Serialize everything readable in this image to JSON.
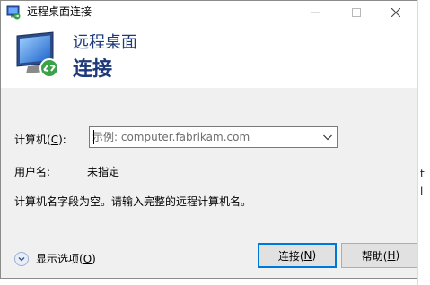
{
  "window": {
    "title": "远程桌面连接"
  },
  "header": {
    "line1": "远程桌面",
    "line2": "连接"
  },
  "form": {
    "computer_label_pre": "计算机(",
    "computer_label_key": "C",
    "computer_label_post": "):",
    "computer_placeholder": "示例: computer.fabrikam.com",
    "computer_value": "",
    "user_label": "用户名:",
    "user_value": "未指定",
    "message": "计算机名字段为空。请输入完整的远程计算机名。"
  },
  "footer": {
    "options_pre": "显示选项(",
    "options_key": "O",
    "options_post": ")",
    "connect_pre": "连接(",
    "connect_key": "N",
    "connect_post": ")",
    "help_pre": "帮助(",
    "help_key": "H",
    "help_post": ")"
  },
  "icons": {
    "app": "remote-desktop-icon",
    "header": "remote-desktop-icon",
    "minimize": "minimize-icon",
    "maximize": "maximize-icon",
    "close": "close-icon",
    "dropdown": "chevron-down-icon",
    "options": "chevron-down-icon"
  },
  "colors": {
    "accent": "#0078d7",
    "header_text": "#1e3a7a",
    "window_bg": "#f0f0f0"
  },
  "background_window": {
    "text": "t\nl"
  }
}
